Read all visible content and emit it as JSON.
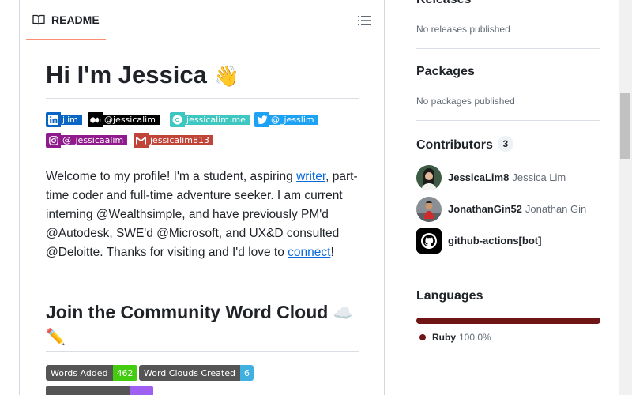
{
  "readme": {
    "tab_label": "README",
    "title": "Hi I'm Jessica",
    "title_emoji": "👋",
    "badges": [
      {
        "label": "jlim",
        "color": "#0a66c2",
        "icon": "linkedin-icon"
      },
      {
        "label": "@jessicalim",
        "color": "#000000",
        "icon": "medium-icon"
      },
      {
        "label": "jessicalim.me",
        "color": "#3ec7c0",
        "icon": "chrome-icon"
      },
      {
        "label": "@_jesslim",
        "color": "#1da1f2",
        "icon": "twitter-icon"
      },
      {
        "label": "@_jessicaalim",
        "color": "#8f1b8c",
        "icon": "instagram-icon"
      },
      {
        "label": "jessicalim813",
        "color": "#c14438",
        "icon": "gmail-icon"
      }
    ],
    "intro": {
      "part1": "Welcome to my profile! I'm a student, aspiring ",
      "link1": "writer",
      "part2": ", part-time coder and full-time adventure seeker. I am current interning @Wealthsimple, and have previously PM'd @Autodesk, SWE'd @Microsoft, and UX&D consulted @Deloitte. Thanks for visiting and I'd love to ",
      "link2": "connect",
      "part3": "!"
    },
    "section_heading": "Join the Community Word Cloud",
    "section_emoji_cloud": "☁️",
    "section_emoji_pencil": "✏️",
    "stats": [
      {
        "label": "Words Added",
        "value": "462",
        "color": "#4c1"
      },
      {
        "label": "Word Clouds Created",
        "value": "6",
        "color": "#3fb0e0"
      }
    ]
  },
  "sidebar": {
    "releases": {
      "heading": "Releases",
      "empty": "No releases published"
    },
    "packages": {
      "heading": "Packages",
      "empty": "No packages published"
    },
    "contributors": {
      "heading": "Contributors",
      "count": "3",
      "items": [
        {
          "login": "JessicaLim8",
          "name": "Jessica Lim"
        },
        {
          "login": "JonathanGin52",
          "name": "Jonathan Gin"
        },
        {
          "login": "github-actions[bot]",
          "name": ""
        }
      ]
    },
    "languages": {
      "heading": "Languages",
      "items": [
        {
          "name": "Ruby",
          "percent": "100.0%",
          "fraction": 1.0,
          "color": "#701516"
        }
      ]
    }
  }
}
